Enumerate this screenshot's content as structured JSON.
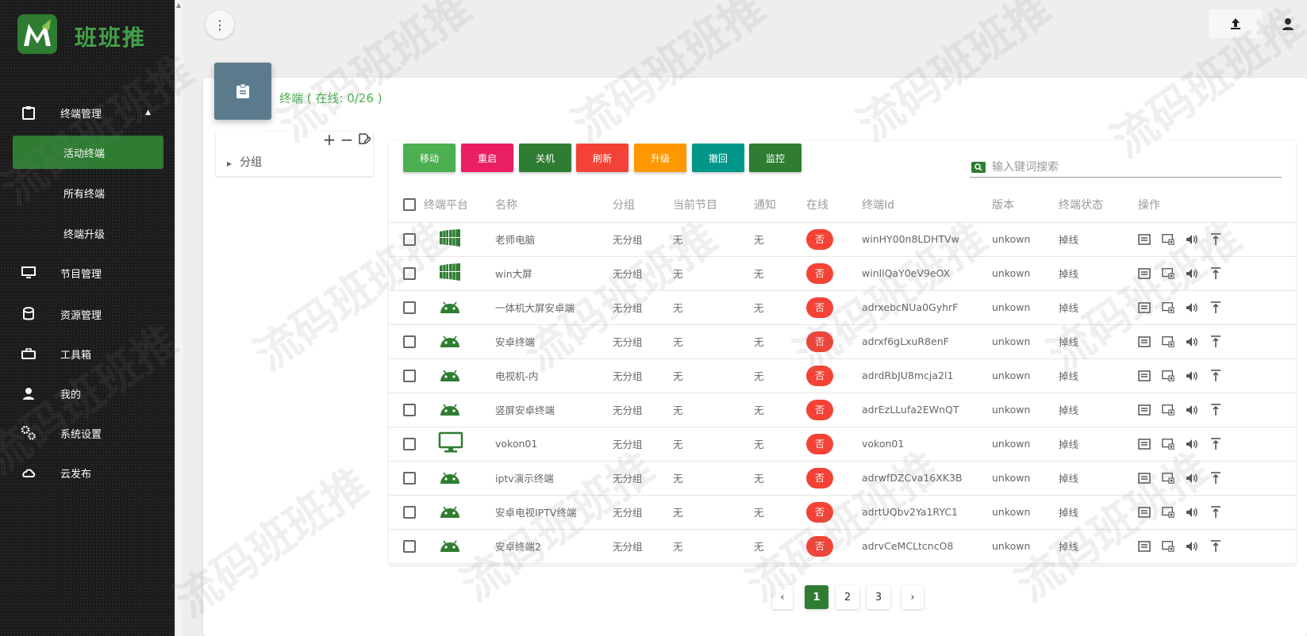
{
  "brand": {
    "name": "班班推"
  },
  "sidebar": {
    "items": [
      {
        "label": "终端管理",
        "icon": "clipboard-icon",
        "caret": "▲"
      },
      {
        "label": "节目管理",
        "icon": "monitor-icon",
        "caret": ""
      },
      {
        "label": "资源管理",
        "icon": "database-icon",
        "caret": ""
      },
      {
        "label": "工具箱",
        "icon": "toolbox-icon",
        "caret": ""
      },
      {
        "label": "我的",
        "icon": "user-icon",
        "caret": ""
      },
      {
        "label": "系统设置",
        "icon": "gears-icon",
        "caret": ""
      },
      {
        "label": "云发布",
        "icon": "cloud-upload-icon",
        "caret": ""
      }
    ],
    "sub_items": [
      {
        "label": "活动终端",
        "active": true
      },
      {
        "label": "所有终端",
        "active": false
      },
      {
        "label": "终端升级",
        "active": false
      }
    ]
  },
  "card": {
    "title": "终端 ( 在线: 0/26 )"
  },
  "tree": {
    "root_label": "分组",
    "add": "+",
    "remove": "−"
  },
  "actions": [
    {
      "label": "移动",
      "color": "#4caf50"
    },
    {
      "label": "重启",
      "color": "#e91e63"
    },
    {
      "label": "关机",
      "color": "#2e7d32"
    },
    {
      "label": "刷新",
      "color": "#f44336"
    },
    {
      "label": "升级",
      "color": "#ff9800"
    },
    {
      "label": "撤回",
      "color": "#009688"
    },
    {
      "label": "监控",
      "color": "#2e7d32"
    }
  ],
  "search": {
    "placeholder": "输入键词搜索"
  },
  "table": {
    "headers": [
      "终端平台",
      "名称",
      "分组",
      "当前节目",
      "通知",
      "在线",
      "终端Id",
      "版本",
      "终端状态",
      "操作"
    ],
    "rows": [
      {
        "platform": "windows",
        "name": "老师电脑",
        "group": "无分组",
        "program": "无",
        "notice": "无",
        "online": "否",
        "id": "winHY00n8LDHTVw",
        "version": "unkown",
        "status": "掉线"
      },
      {
        "platform": "windows",
        "name": "win大屏",
        "group": "无分组",
        "program": "无",
        "notice": "无",
        "online": "否",
        "id": "winllQaY0eV9eOX",
        "version": "unkown",
        "status": "掉线"
      },
      {
        "platform": "android",
        "name": "一体机大屏安卓端",
        "group": "无分组",
        "program": "无",
        "notice": "无",
        "online": "否",
        "id": "adrxebcNUa0GyhrF",
        "version": "unkown",
        "status": "掉线"
      },
      {
        "platform": "android",
        "name": "安卓终端",
        "group": "无分组",
        "program": "无",
        "notice": "无",
        "online": "否",
        "id": "adrxf6gLxuR8enF",
        "version": "unkown",
        "status": "掉线"
      },
      {
        "platform": "android",
        "name": "电视机-内",
        "group": "无分组",
        "program": "无",
        "notice": "无",
        "online": "否",
        "id": "adrdRbJU8mcja2l1",
        "version": "unkown",
        "status": "掉线"
      },
      {
        "platform": "android",
        "name": "竖屏安卓终端",
        "group": "无分组",
        "program": "无",
        "notice": "无",
        "online": "否",
        "id": "adrEzLLufa2EWnQT",
        "version": "unkown",
        "status": "掉线"
      },
      {
        "platform": "monitor",
        "name": "vokon01",
        "group": "无分组",
        "program": "无",
        "notice": "无",
        "online": "否",
        "id": "vokon01",
        "version": "unkown",
        "status": "掉线"
      },
      {
        "platform": "android",
        "name": "iptv演示终端",
        "group": "无分组",
        "program": "无",
        "notice": "无",
        "online": "否",
        "id": "adrwfDZCva16XK3B",
        "version": "unkown",
        "status": "掉线"
      },
      {
        "platform": "android",
        "name": "安卓电视IPTV终端",
        "group": "无分组",
        "program": "无",
        "notice": "无",
        "online": "否",
        "id": "adrtUQbv2Ya1RYC1",
        "version": "unkown",
        "status": "掉线"
      },
      {
        "platform": "android",
        "name": "安卓终端2",
        "group": "无分组",
        "program": "无",
        "notice": "无",
        "online": "否",
        "id": "adrvCeMCLtcncO8",
        "version": "unkown",
        "status": "掉线"
      }
    ]
  },
  "pagination": {
    "prev": "‹",
    "pages": [
      "1",
      "2",
      "3"
    ],
    "current": "1",
    "next": "›"
  },
  "watermark": "流码班班推",
  "colors": {
    "accent": "#2e7d32",
    "online_no": "#f44336",
    "sidebar_bg": "#1b1b1b"
  }
}
